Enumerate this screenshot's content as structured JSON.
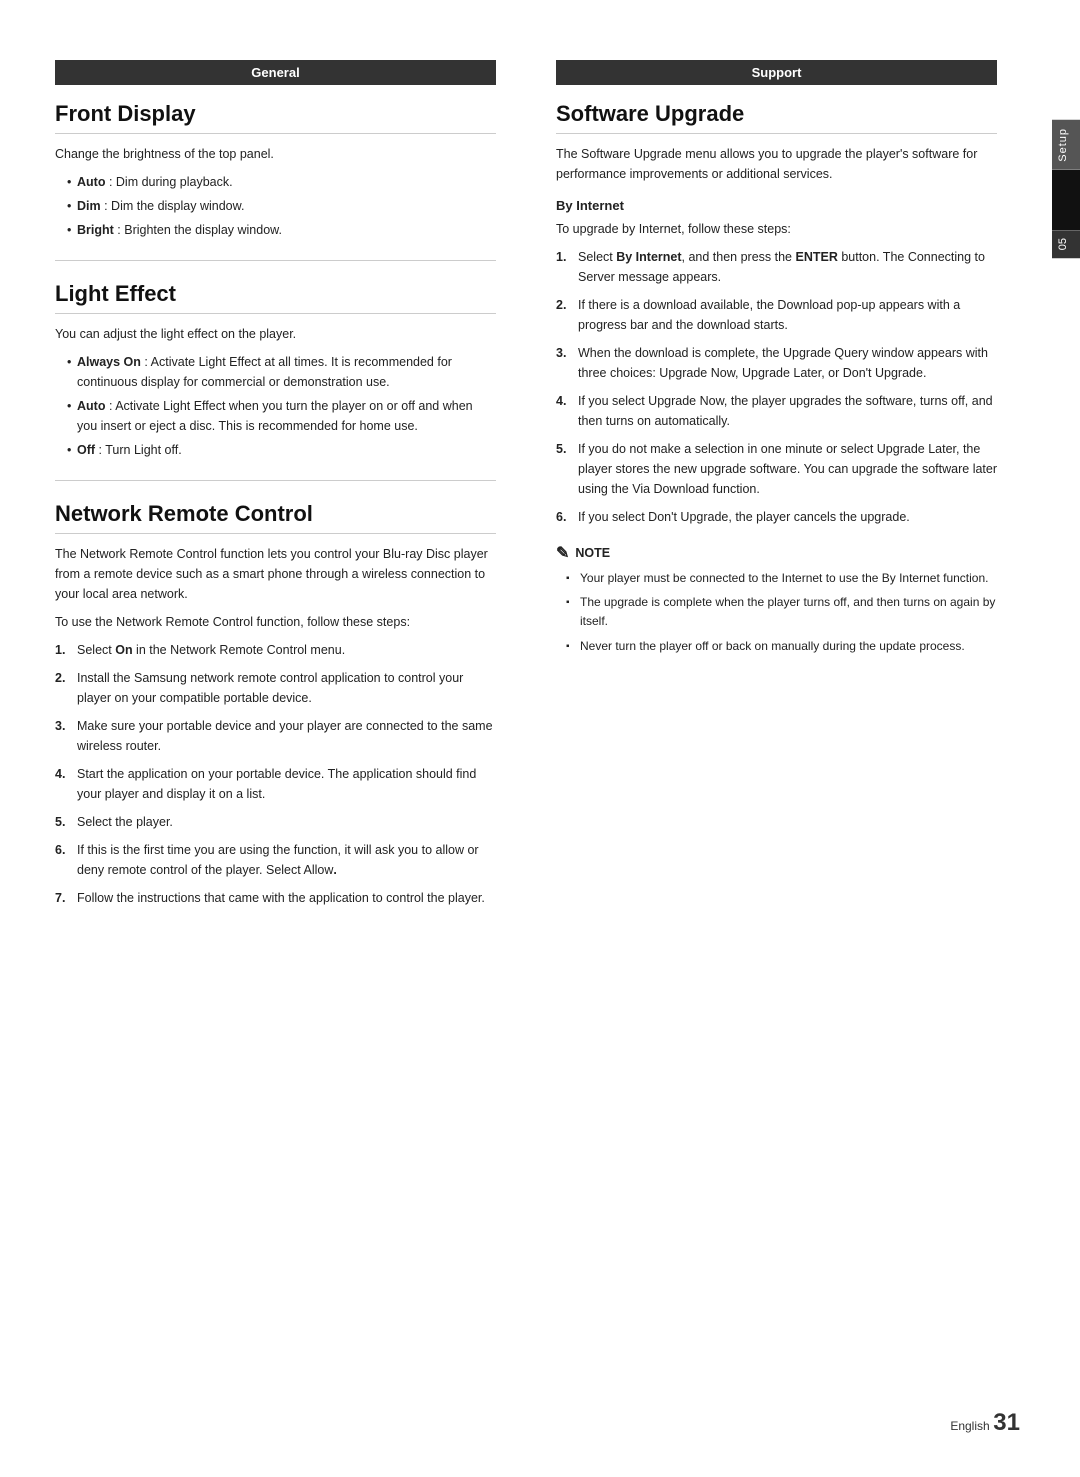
{
  "page": {
    "number": "31",
    "language": "English",
    "side_tab": {
      "label": "Setup",
      "number": "05"
    }
  },
  "left_column": {
    "header": "General",
    "sections": [
      {
        "title": "Front Display",
        "intro": "Change the brightness of the top panel.",
        "bullets": [
          "<b>Auto</b> : Dim during playback.",
          "<b>Dim</b> : Dim the display window.",
          "<b>Bright</b> : Brighten the display window."
        ]
      },
      {
        "title": "Light Effect",
        "intro": "You can adjust the light effect on the player.",
        "bullets": [
          "<b>Always On</b> : Activate Light Effect at all times. It is recommended for continuous display for commercial or demonstration use.",
          "<b>Auto</b> : Activate Light Effect when you turn the player on or off and when you insert or eject a disc. This is recommended for home use.",
          "<b>Off</b> : Turn Light off."
        ]
      },
      {
        "title": "Network Remote Control",
        "intro": "The Network Remote Control function lets you control your Blu-ray Disc player from a remote device such as a smart phone through a wireless connection to your local area network.",
        "intro2": "To use the Network Remote Control function, follow these steps:",
        "steps": [
          "Select <b>On</b> in the Network Remote Control menu.",
          "Install the Samsung network remote control application to control your player on your compatible portable device.",
          "Make sure your portable device and your player are connected to the same wireless router.",
          "Start the application on your portable device. The application should find your player and display it on a list.",
          "Select the player.",
          "If this is the first time you are using the function, it will ask you to allow or deny remote control of the player. Select Allow.",
          "Follow the instructions that came with the application to control the player."
        ]
      }
    ]
  },
  "right_column": {
    "header": "Support",
    "sections": [
      {
        "title": "Software Upgrade",
        "intro": "The Software Upgrade menu allows you to upgrade the player's software for performance improvements or additional services.",
        "subsections": [
          {
            "title": "By Internet",
            "intro": "To upgrade by Internet, follow these steps:",
            "steps": [
              "Select <b>By Internet</b>, and then press the <b>ENTER</b> button. The Connecting to Server message appears.",
              "If there is a download available, the Download pop-up appears with a progress bar and the download starts.",
              "When the download is complete, the Upgrade Query window appears with three choices: Upgrade Now, Upgrade Later, or Don't Upgrade.",
              "If you select Upgrade Now, the player upgrades the software, turns off, and then turns on automatically.",
              "If you do not make a selection in one minute or select Upgrade Later, the player stores the new upgrade software. You can upgrade the software later using the Via Download function.",
              "If you select Don't Upgrade, the player cancels the upgrade."
            ]
          }
        ],
        "note": {
          "label": "NOTE",
          "items": [
            "Your player must be connected to the Internet to use the By Internet function.",
            "The upgrade is complete when the player turns off, and then turns on again by itself.",
            "Never turn the player off or back on manually during the update process."
          ]
        }
      }
    ]
  }
}
